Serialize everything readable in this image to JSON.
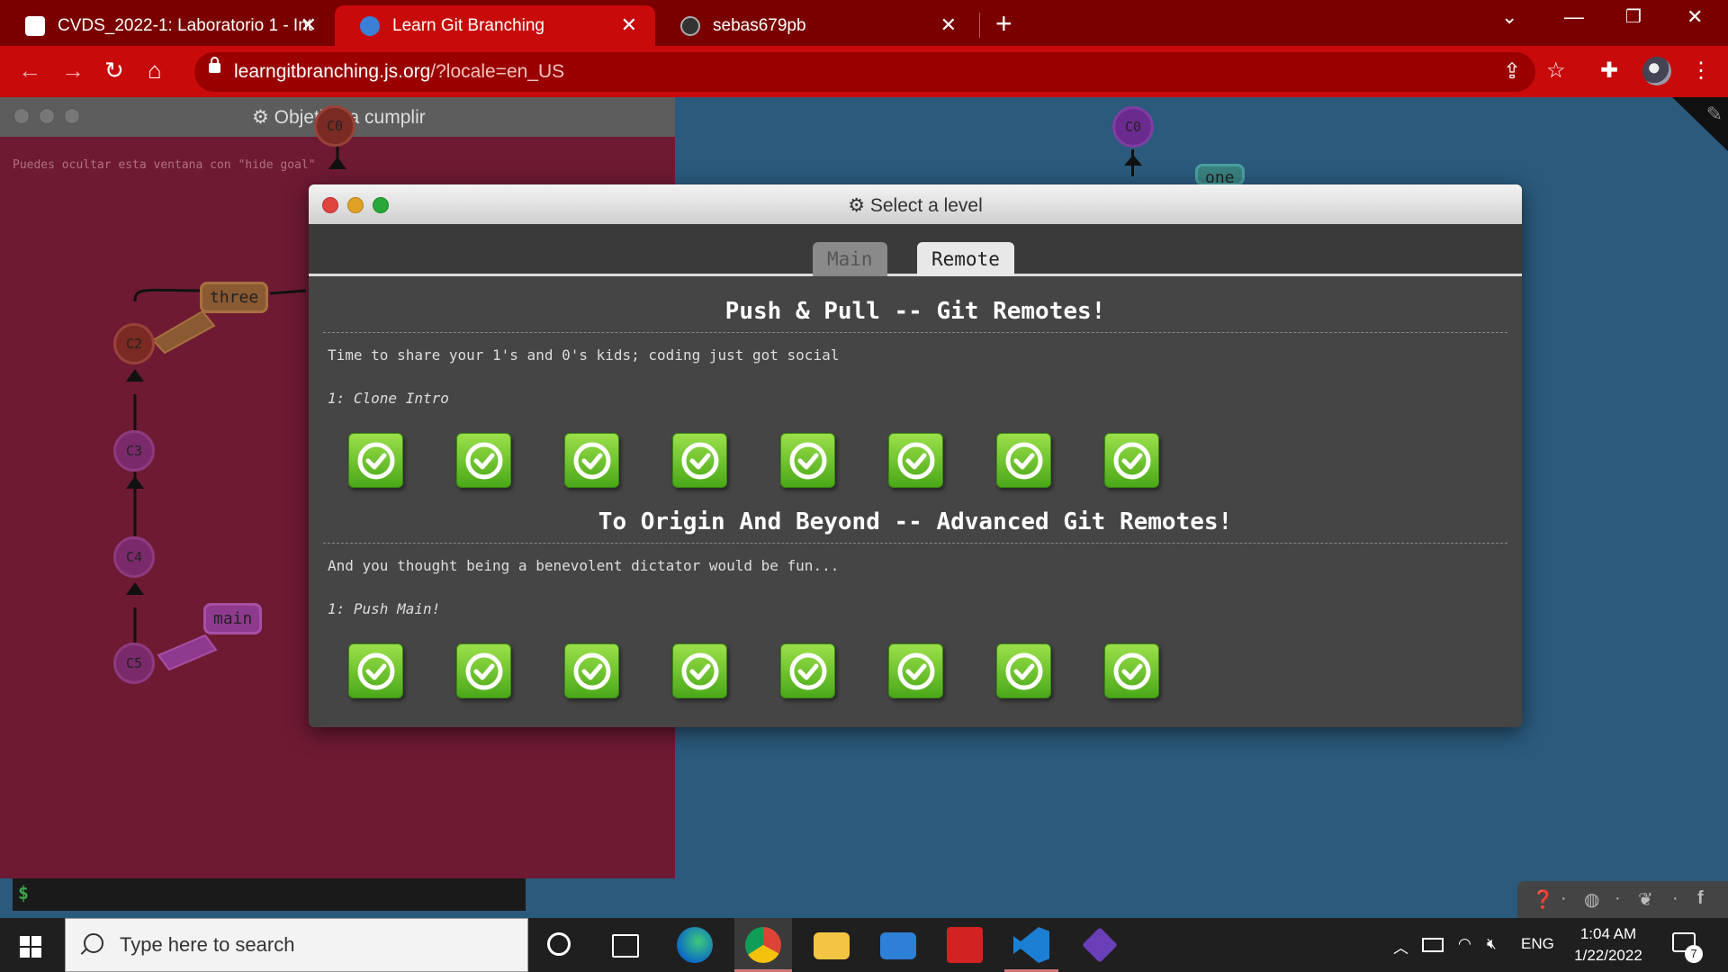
{
  "browser": {
    "tabs": [
      {
        "title": "CVDS_2022-1: Laboratorio 1 - Int",
        "active": false
      },
      {
        "title": "Learn Git Branching",
        "active": true
      },
      {
        "title": "sebas679pb",
        "active": false
      }
    ],
    "url_host": "learngitbranching.js.org",
    "url_path": "/?locale=en_US"
  },
  "goal_window": {
    "title": "Objetivo a cumplir",
    "hint": "Puedes ocultar esta ventana con \"hide goal\""
  },
  "graph": {
    "commits": [
      "C0",
      "C2",
      "C3",
      "C4",
      "C5",
      "C0"
    ],
    "branches": [
      "three",
      "main",
      "one"
    ]
  },
  "terminal": {
    "prompt": "$"
  },
  "modal": {
    "title": "Select a level",
    "tabs": [
      "Main",
      "Remote"
    ],
    "active_tab": "Remote",
    "sequences": [
      {
        "title": "Push & Pull -- Git Remotes!",
        "about": "Time to share your 1's and 0's kids; coding just got social",
        "selected_level": "1: Clone Intro",
        "levels_completed": 8
      },
      {
        "title": "To Origin And Beyond -- Advanced Git Remotes!",
        "about": "And you thought being a benevolent dictator would be fun...",
        "selected_level": "1: Push Main!",
        "levels_completed": 8
      }
    ]
  },
  "taskbar": {
    "search_placeholder": "Type here to search",
    "language": "ENG",
    "time": "1:04 AM",
    "date": "1/22/2022",
    "notification_count": "7"
  },
  "colors": {
    "chrome_frame": "#7a0000",
    "chrome_toolbar": "#c80a0a",
    "goal_bg": "#6e1a33",
    "page_bg": "#2b5a7c",
    "level_done": "#6cc52a"
  }
}
